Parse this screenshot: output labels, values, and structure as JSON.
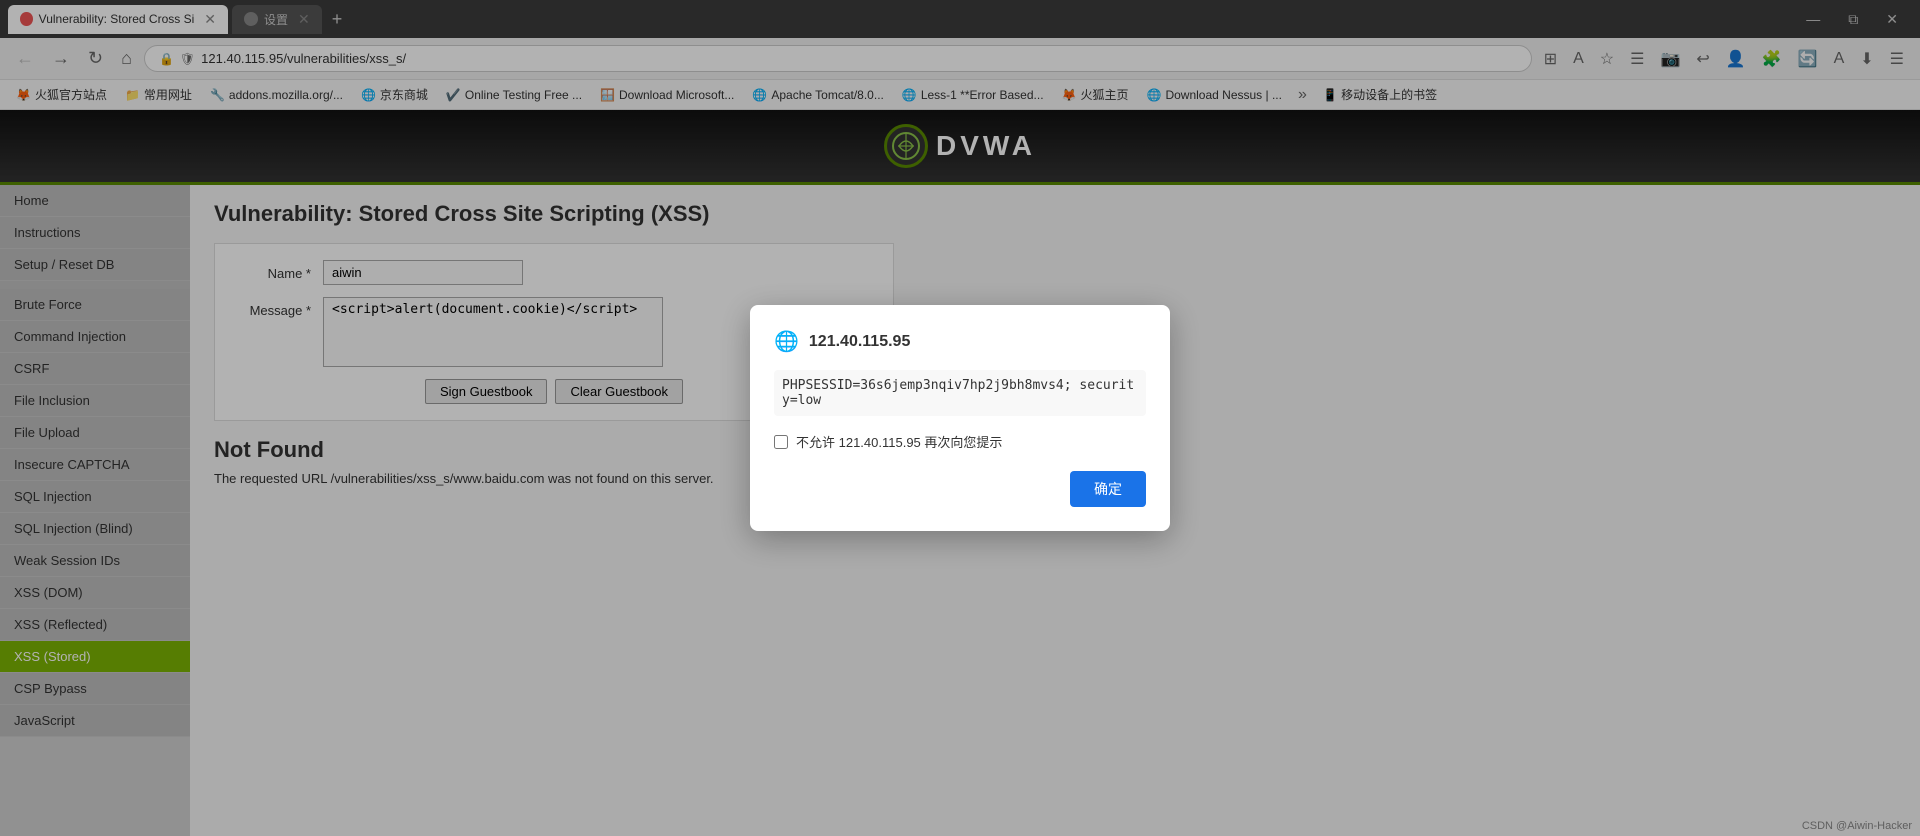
{
  "browser": {
    "tabs": [
      {
        "id": "tab1",
        "label": "Vulnerability: Stored Cross Si",
        "active": true,
        "favicon": "fire"
      },
      {
        "id": "tab2",
        "label": "设置",
        "active": false,
        "favicon": "gear"
      }
    ],
    "address_bar": "121.40.115.95/vulnerabilities/xss_s/",
    "win_controls": [
      "minimize",
      "restore",
      "close"
    ]
  },
  "bookmarks": [
    {
      "label": "火狐官方站点",
      "icon": "🦊"
    },
    {
      "label": "常用网址",
      "icon": "📁"
    },
    {
      "label": "addons.mozilla.org/...",
      "icon": "🔧"
    },
    {
      "label": "京东商城",
      "icon": "🌐"
    },
    {
      "label": "Online Testing Free ...",
      "icon": "✔️"
    },
    {
      "label": "Download Microsoft...",
      "icon": "🪟"
    },
    {
      "label": "Apache Tomcat/8.0...",
      "icon": "🌐"
    },
    {
      "label": "Less-1 **Error Based...",
      "icon": "🌐"
    },
    {
      "label": "火狐主页",
      "icon": "🦊"
    },
    {
      "label": "Download Nessus | ...",
      "icon": "🌐"
    }
  ],
  "dvwa": {
    "logo": "DVWA",
    "page_title": "Vulnerability: Stored Cross Site Scripting (XSS)",
    "sidebar": {
      "top_items": [
        {
          "label": "Home",
          "active": false
        },
        {
          "label": "Instructions",
          "active": false
        },
        {
          "label": "Setup / Reset DB",
          "active": false
        }
      ],
      "vuln_items": [
        {
          "label": "Brute Force",
          "active": false
        },
        {
          "label": "Command Injection",
          "active": false
        },
        {
          "label": "CSRF",
          "active": false
        },
        {
          "label": "File Inclusion",
          "active": false
        },
        {
          "label": "File Upload",
          "active": false
        },
        {
          "label": "Insecure CAPTCHA",
          "active": false
        },
        {
          "label": "SQL Injection",
          "active": false
        },
        {
          "label": "SQL Injection (Blind)",
          "active": false
        },
        {
          "label": "Weak Session IDs",
          "active": false
        },
        {
          "label": "XSS (DOM)",
          "active": false
        },
        {
          "label": "XSS (Reflected)",
          "active": false
        },
        {
          "label": "XSS (Stored)",
          "active": true
        },
        {
          "label": "CSP Bypass",
          "active": false
        },
        {
          "label": "JavaScript",
          "active": false
        }
      ]
    },
    "form": {
      "name_label": "Name *",
      "name_value": "aiwin",
      "message_label": "Message *",
      "message_value": "<script>alert(document.cookie)</script>",
      "sign_btn": "Sign Guestbook",
      "clear_btn": "Clear Guestbook"
    },
    "not_found": {
      "title": "Not Found",
      "text": "The requested URL /vulnerabilities/xss_s/www.baidu.com was not found on this server."
    },
    "watermark": "CSDN @Aiwin-Hacker"
  },
  "alert_dialog": {
    "icon": "🌐",
    "domain": "121.40.115.95",
    "message": "PHPSESSID=36s6jemp3nqiv7hp2j9bh8mvs4; security=low",
    "checkbox_label": "不允许 121.40.115.95 再次向您提示",
    "ok_btn": "确定"
  }
}
